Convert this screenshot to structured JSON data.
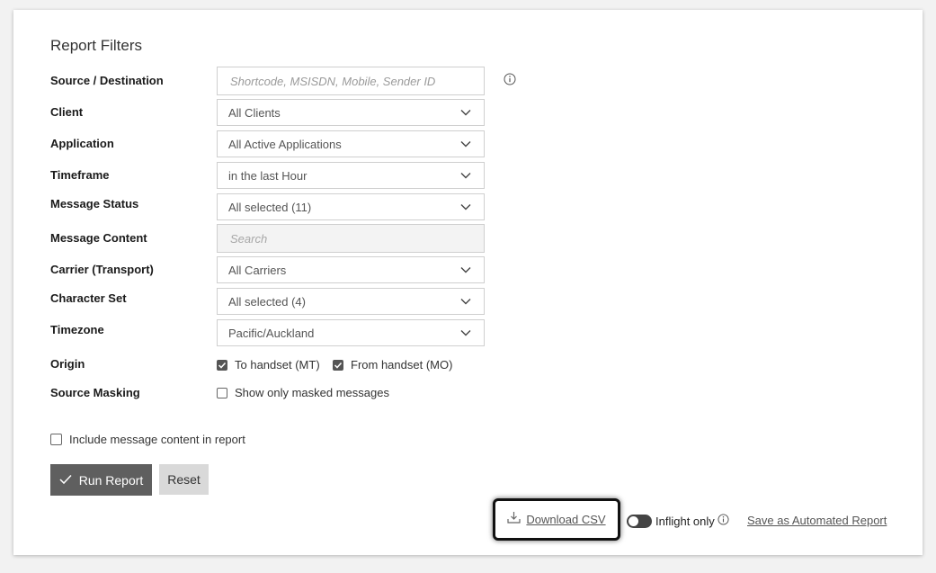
{
  "title": "Report Filters",
  "labels": {
    "source_destination": "Source / Destination",
    "client": "Client",
    "application": "Application",
    "timeframe": "Timeframe",
    "message_status": "Message Status",
    "message_content": "Message Content",
    "carrier": "Carrier (Transport)",
    "character_set": "Character Set",
    "timezone": "Timezone",
    "origin": "Origin",
    "source_masking": "Source Masking"
  },
  "fields": {
    "source_destination_placeholder": "Shortcode, MSISDN, Mobile, Sender ID",
    "client": "All Clients",
    "application": "All Active Applications",
    "timeframe": "in the last Hour",
    "message_status": "All selected (11)",
    "message_content_placeholder": "Search",
    "carrier": "All Carriers",
    "character_set": "All selected (4)",
    "timezone": "Pacific/Auckland"
  },
  "origin": {
    "mt_label": "To handset (MT)",
    "mt_checked": true,
    "mo_label": "From handset (MO)",
    "mo_checked": true
  },
  "source_masking": {
    "label": "Show only masked messages",
    "checked": false
  },
  "include_content": {
    "label": "Include message content in report",
    "checked": false
  },
  "buttons": {
    "run": "Run Report",
    "reset": "Reset"
  },
  "footer": {
    "download": "Download CSV",
    "inflight": "Inflight only",
    "save": "Save as Automated Report"
  },
  "icons": {
    "info": "info-circle-icon",
    "chevron": "chevron-down-icon",
    "check": "check-icon",
    "download": "download-icon"
  },
  "colors": {
    "run_button": "#5f5f5f",
    "reset_button": "#d9d9d9",
    "checkbox_checked": "#555555"
  }
}
